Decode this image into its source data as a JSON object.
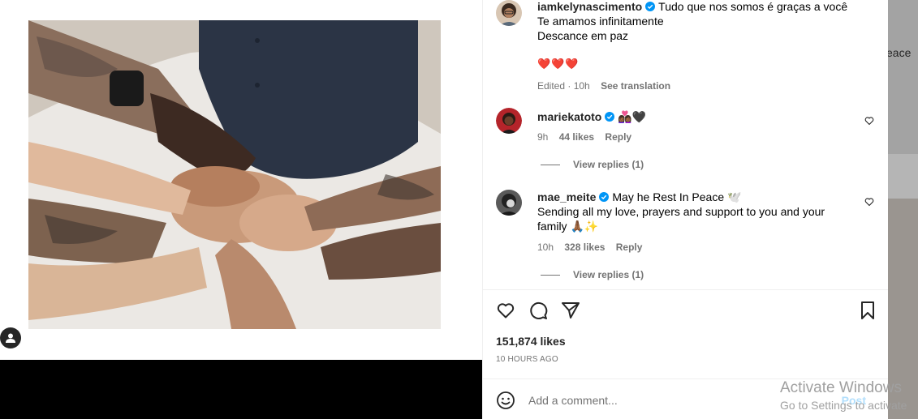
{
  "post": {
    "caption": {
      "username": "iamkelynascimento",
      "lines": [
        "Tudo que nos somos é graças a você",
        "Te amamos infinitamente",
        "Descance em paz"
      ],
      "emojis": "❤️❤️❤️",
      "edited": "Edited · 10h",
      "see_translation": "See translation"
    },
    "comments": [
      {
        "username": "mariekatoto",
        "text": "👩🏾‍❤️‍👩🏾🖤",
        "time": "9h",
        "likes": "44 likes",
        "reply": "Reply",
        "view_replies": "View replies (1)"
      },
      {
        "username": "mae_meite",
        "text_line1": "May he Rest In Peace 🕊️",
        "text_line2": "Sending all my love, prayers and support to you and your",
        "text_line3": "family 🙏🏾✨",
        "time": "10h",
        "likes": "328 likes",
        "reply": "Reply",
        "view_replies": "View replies (1)"
      }
    ],
    "likes_count": "151,874 likes",
    "timestamp": "10 HOURS AGO",
    "add_comment_placeholder": "Add a comment...",
    "post_button": "Post"
  },
  "background": {
    "edge_text": "eace"
  },
  "os_watermark": {
    "line1": "Activate Windows",
    "line2": "Go to Settings to activate"
  },
  "icons": {
    "like": "heart-icon",
    "comment": "comment-icon",
    "share": "share-icon",
    "save": "bookmark-icon",
    "emoji": "smiley-icon",
    "verified": "verified-badge-icon",
    "user_tag": "user-tag-icon"
  },
  "colors": {
    "verified_blue": "#0095f6",
    "text_primary": "#262626",
    "text_secondary": "#737373",
    "post_button_disabled": "#b2dffc",
    "heart_red": "#ed1c24"
  }
}
